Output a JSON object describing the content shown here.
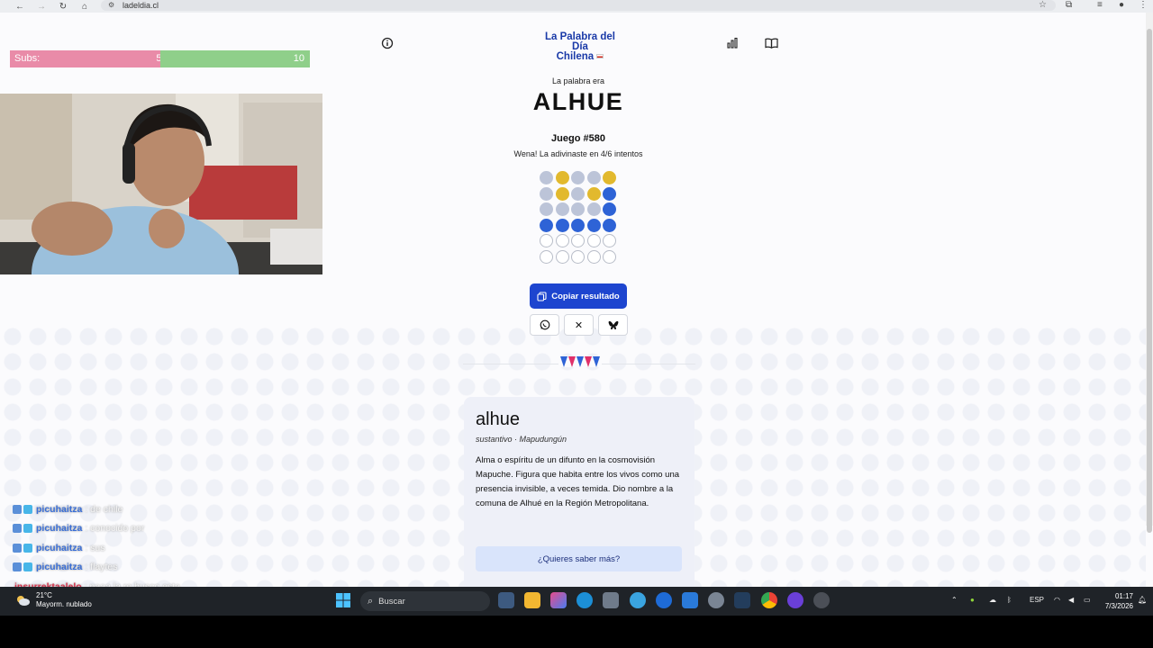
{
  "browser": {
    "url": "ladeldia.cl"
  },
  "header": {
    "logo_top": "La Palabra del Día",
    "logo_bottom": "Chilena"
  },
  "result": {
    "reveal_label": "La palabra era",
    "word": "ALHUE",
    "game_label": "Juego #580",
    "message": "Wena! La adivinaste en 4/6 intentos",
    "grid": [
      [
        "g",
        "y",
        "g",
        "g",
        "y"
      ],
      [
        "g",
        "y",
        "g",
        "y",
        "b"
      ],
      [
        "g",
        "g",
        "g",
        "g",
        "b"
      ],
      [
        "b",
        "b",
        "b",
        "b",
        "b"
      ],
      [
        "e",
        "e",
        "e",
        "e",
        "e"
      ],
      [
        "e",
        "e",
        "e",
        "e",
        "e"
      ]
    ],
    "copy_label": "Copiar resultado"
  },
  "definition": {
    "word": "alhue",
    "type": "sustantivo · Mapudungún",
    "text": "Alma o espíritu de un difunto en la cosmovisión Mapuche. Figura que habita entre los vivos como una presencia invisible, a veces temida. Dio nombre a la comuna de Alhué en la Región Metropolitana.",
    "more_label": "¿Quieres saber más?"
  },
  "overlay": {
    "subs_label": "Subs:",
    "subs_current": "5",
    "subs_goal": "10",
    "subs_progress": 0.5
  },
  "chat": [
    {
      "user": "picuhaitza",
      "message": ": de chile"
    },
    {
      "user": "picuhaitza",
      "message": ": conocido por"
    },
    {
      "user": "picuhaitza",
      "message": ": sus"
    },
    {
      "user": "picuhaitza",
      "message": ": flaytes"
    },
    {
      "user": "insurrektaalelo",
      "message": ": naaa la re busco esta"
    }
  ],
  "taskbar": {
    "weather_temp": "21°C",
    "weather_desc": "Mayorm. nublado",
    "search_placeholder": "Buscar",
    "lang": "ESP",
    "time": "01:17",
    "date": "7/3/2026"
  },
  "colors": {
    "primary": "#1d45cf",
    "yellow": "#e2b92e",
    "blue": "#2e63d6",
    "gray": "#bcc4d8"
  }
}
